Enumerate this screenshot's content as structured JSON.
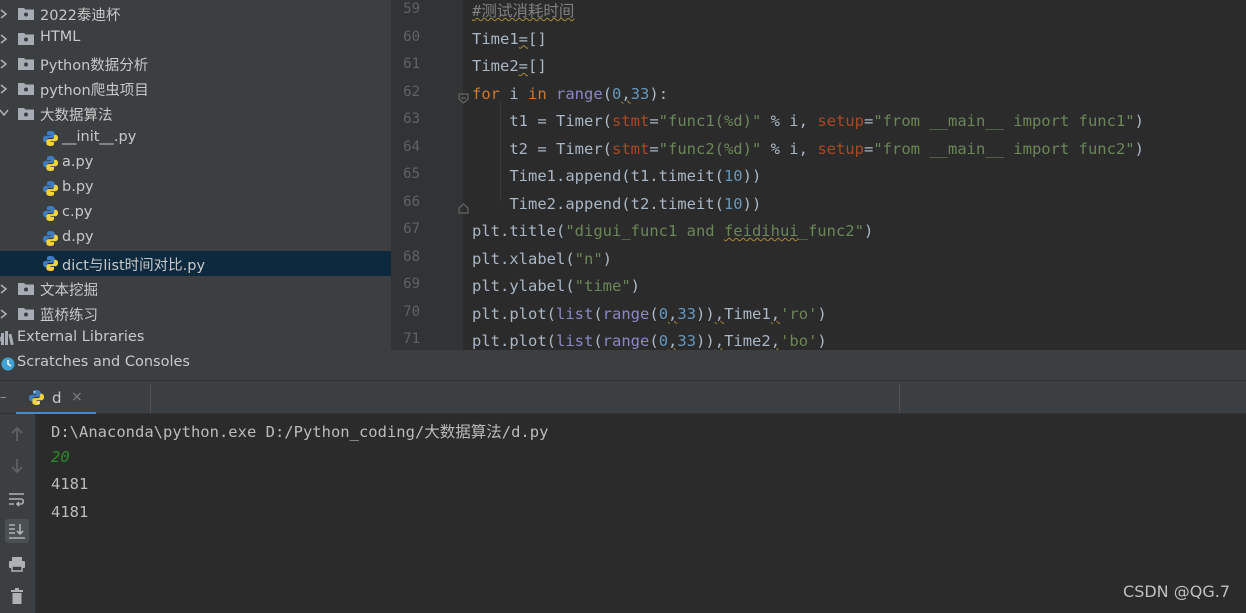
{
  "project_tree": {
    "items": [
      {
        "label": "2022泰迪杯",
        "kind": "folder"
      },
      {
        "label": "HTML",
        "kind": "folder"
      },
      {
        "label": "Python数据分析",
        "kind": "folder"
      },
      {
        "label": "python爬虫项目",
        "kind": "folder"
      },
      {
        "label": "大数据算法",
        "kind": "folder-open"
      },
      {
        "label": "__init__.py",
        "kind": "py"
      },
      {
        "label": "a.py",
        "kind": "py"
      },
      {
        "label": "b.py",
        "kind": "py"
      },
      {
        "label": "c.py",
        "kind": "py"
      },
      {
        "label": "d.py",
        "kind": "py"
      },
      {
        "label": "dict与list时间对比.py",
        "kind": "py",
        "selected": true
      },
      {
        "label": "文本挖掘",
        "kind": "folder"
      },
      {
        "label": "蓝桥练习",
        "kind": "folder"
      },
      {
        "label": "External Libraries",
        "kind": "libraries"
      },
      {
        "label": "Scratches and Consoles",
        "kind": "scratches"
      }
    ]
  },
  "editor": {
    "line_numbers": [
      "59",
      "60",
      "61",
      "62",
      "63",
      "64",
      "65",
      "66",
      "67",
      "68",
      "69",
      "70",
      "71"
    ],
    "lines": [
      "#测试消耗时间",
      "Time1=[]",
      "Time2=[]",
      "for i in range(0,33):",
      "    t1 = Timer(stmt=\"func1(%d)\" % i, setup=\"from __main__ import func1\")",
      "    t2 = Timer(stmt=\"func2(%d)\" % i, setup=\"from __main__ import func2\")",
      "    Time1.append(t1.timeit(10))",
      "    Time2.append(t2.timeit(10))",
      "plt.title(\"digui_func1 and feidihui_func2\")",
      "plt.xlabel(\"n\")",
      "plt.ylabel(\"time\")",
      "plt.plot(list(range(0,33)),Time1,'ro')",
      "plt.plot(list(range(0,33)),Time2,'bo')"
    ]
  },
  "run_panel": {
    "tab_label": "d",
    "tab_close": "×",
    "minimize": "–",
    "output": [
      {
        "text": "D:\\Anaconda\\python.exe D:/Python_coding/大数据算法/d.py",
        "style": "normal"
      },
      {
        "text": "20",
        "style": "green"
      },
      {
        "text": "4181",
        "style": "normal"
      },
      {
        "text": "4181",
        "style": "normal"
      }
    ],
    "toolbar": [
      "up-arrow-icon",
      "down-arrow-icon",
      "soft-wrap-icon",
      "scroll-to-end-icon",
      "print-icon",
      "trash-icon"
    ]
  },
  "watermark": "CSDN @QG.7",
  "colors": {
    "tree_bg": "#3c3f41",
    "editor_bg": "#2b2b2b",
    "selection": "#0d293e",
    "keyword": "#cc7832",
    "string": "#6a8759",
    "number": "#6897bb",
    "accent": "#4a88c7"
  }
}
